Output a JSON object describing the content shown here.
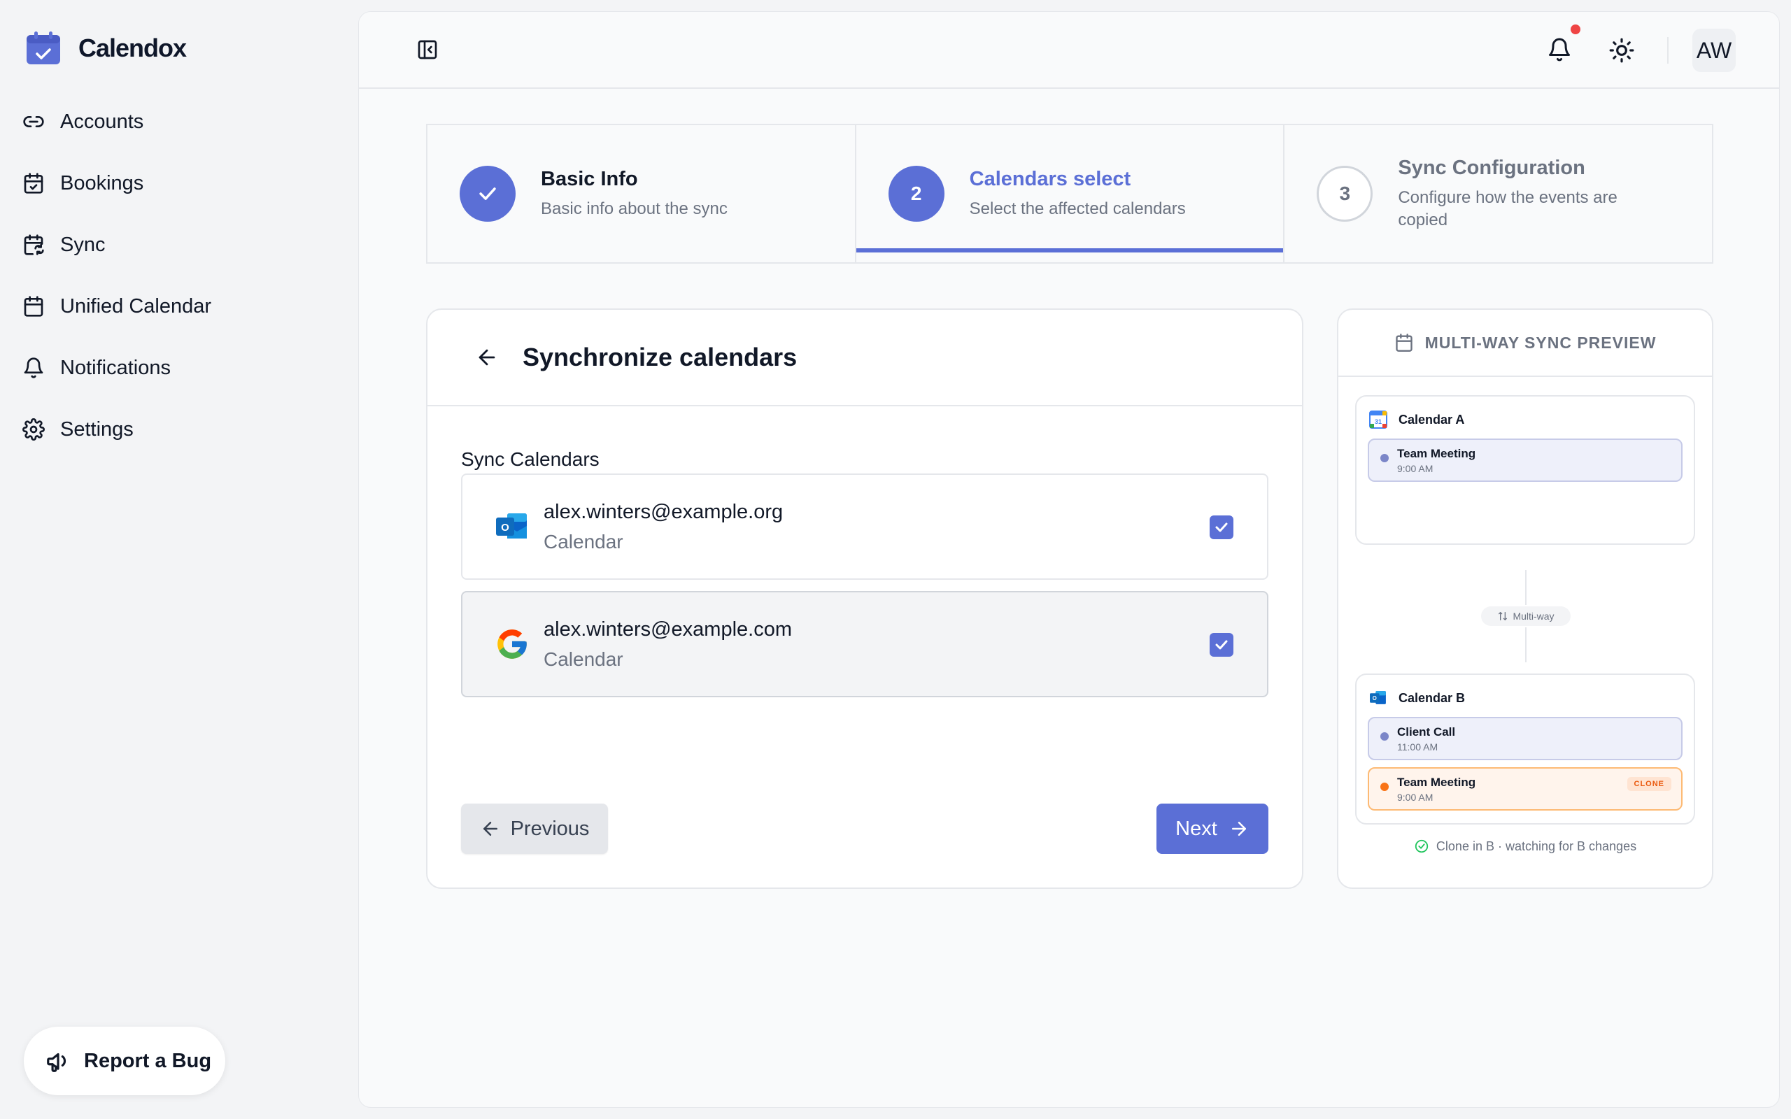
{
  "app": {
    "name": "Calendox",
    "brand_color": "#5b6fd6"
  },
  "sidebar": {
    "items": [
      {
        "label": "Accounts",
        "icon": "link-icon"
      },
      {
        "label": "Bookings",
        "icon": "calendar-check-icon"
      },
      {
        "label": "Sync",
        "icon": "calendar-sync-icon"
      },
      {
        "label": "Unified Calendar",
        "icon": "calendar-icon"
      },
      {
        "label": "Notifications",
        "icon": "bell-icon"
      },
      {
        "label": "Settings",
        "icon": "gear-icon"
      }
    ],
    "report_bug_label": "Report a Bug"
  },
  "topbar": {
    "avatar_initials": "AW",
    "notification_dot_color": "#ef4444"
  },
  "stepper": {
    "steps": [
      {
        "number": "1",
        "title": "Basic Info",
        "description": "Basic info about the sync",
        "state": "done"
      },
      {
        "number": "2",
        "title": "Calendars select",
        "description": "Select the affected calendars",
        "state": "active"
      },
      {
        "number": "3",
        "title": "Sync Configuration",
        "description": "Configure how the events are copied",
        "state": "todo"
      }
    ]
  },
  "card": {
    "title": "Synchronize calendars",
    "section_label": "Sync Calendars",
    "calendars": [
      {
        "email": "alex.winters@example.org",
        "sublabel": "Calendar",
        "provider": "outlook-icon",
        "checked": true
      },
      {
        "email": "alex.winters@example.com",
        "sublabel": "Calendar",
        "provider": "google-icon",
        "checked": true
      }
    ],
    "previous_label": "Previous",
    "next_label": "Next"
  },
  "preview": {
    "title": "MULTI-WAY SYNC PREVIEW",
    "calendar_a": {
      "name": "Calendar A",
      "events": [
        {
          "title": "Team Meeting",
          "time": "9:00 AM"
        }
      ]
    },
    "connector_label": "Multi-way",
    "calendar_b": {
      "name": "Calendar B",
      "events": [
        {
          "title": "Client Call",
          "time": "11:00 AM"
        },
        {
          "title": "Team Meeting",
          "time": "9:00 AM",
          "badge": "CLONE"
        }
      ]
    },
    "footer": "Clone in B · watching for B changes"
  }
}
